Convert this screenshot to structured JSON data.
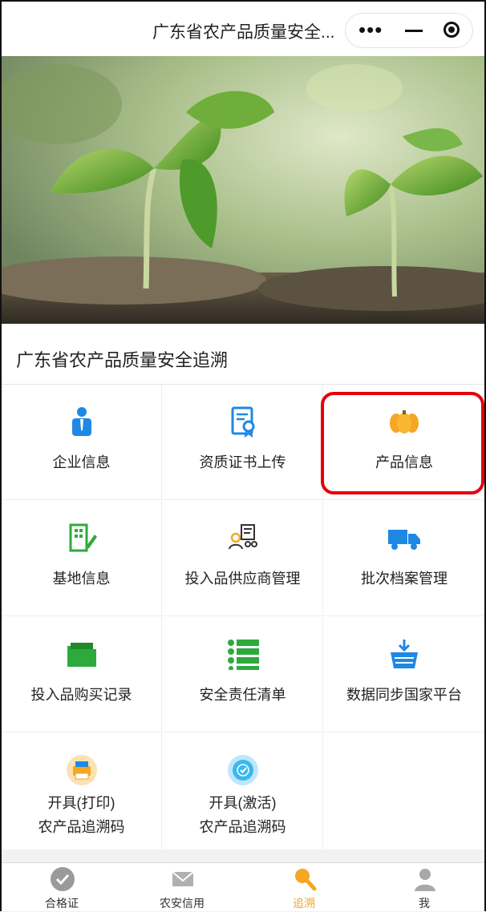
{
  "header": {
    "title": "广东省农产品质量安全...",
    "more_icon": "more-dots-icon",
    "minimize_icon": "minimize-icon",
    "close_icon": "target-icon"
  },
  "page": {
    "section_title": "广东省农产品质量安全追溯"
  },
  "menu": [
    {
      "label": "企业信息",
      "icon": "person-icon",
      "color": "#1e88e5"
    },
    {
      "label": "资质证书上传",
      "icon": "certificate-icon",
      "color": "#1e88e5"
    },
    {
      "label": "产品信息",
      "icon": "pumpkin-icon",
      "color": "#f5a623"
    },
    {
      "label": "基地信息",
      "icon": "building-edit-icon",
      "color": "#2eaa3c"
    },
    {
      "label": "投入品供应商管理",
      "icon": "supplier-icon",
      "color": "#f5a623"
    },
    {
      "label": "批次档案管理",
      "icon": "truck-icon",
      "color": "#1e88e5"
    },
    {
      "label": "投入品购买记录",
      "icon": "folder-icon",
      "color": "#2eaa3c"
    },
    {
      "label": "安全责任清单",
      "icon": "list-icon",
      "color": "#2eaa3c"
    },
    {
      "label": "数据同步国家平台",
      "icon": "basket-download-icon",
      "color": "#1e88e5"
    },
    {
      "label": "开具(打印)",
      "label2": "农产品追溯码",
      "icon": "printer-icon",
      "color": "#f5a623"
    },
    {
      "label": "开具(激活)",
      "label2": "农产品追溯码",
      "icon": "check-circle-icon",
      "color": "#39b8f0"
    }
  ],
  "tabs": [
    {
      "label": "合格证",
      "icon": "check-icon"
    },
    {
      "label": "农安信用",
      "icon": "mail-icon"
    },
    {
      "label": "追溯",
      "icon": "search-icon",
      "active": true
    },
    {
      "label": "我",
      "icon": "user-icon"
    }
  ],
  "colors": {
    "accent": "#f5a623",
    "highlight": "#e5000a"
  }
}
